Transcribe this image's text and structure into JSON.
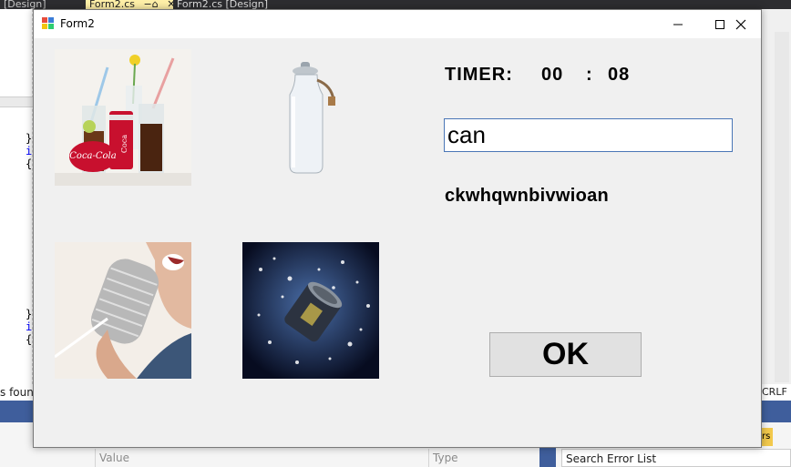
{
  "ide": {
    "tabs": [
      "[Design]",
      "Form2.cs",
      "Form2.cs [Design]"
    ],
    "pin_glyph": "−⌂",
    "close_glyph": "✕",
    "code_lines": [
      "}",
      "i",
      "{",
      "}",
      "i",
      "{"
    ],
    "status_left": "s found",
    "status_right": "CRLF",
    "columns": [
      "Value",
      "Type"
    ],
    "search_placeholder": "Search Error List",
    "right_button_fragment": "rs"
  },
  "form": {
    "title": "Form2",
    "pictures": [
      "coca-cola-can-and-glasses",
      "milk-can",
      "tin-can-telephone",
      "can-splashing-water"
    ],
    "timer": {
      "label": "TIMER:",
      "minutes": "00",
      "separator": ":",
      "seconds": "08"
    },
    "answer": {
      "value": "can"
    },
    "scrambled_word": "ckwhqwnbivwioan",
    "ok_label": "OK"
  }
}
